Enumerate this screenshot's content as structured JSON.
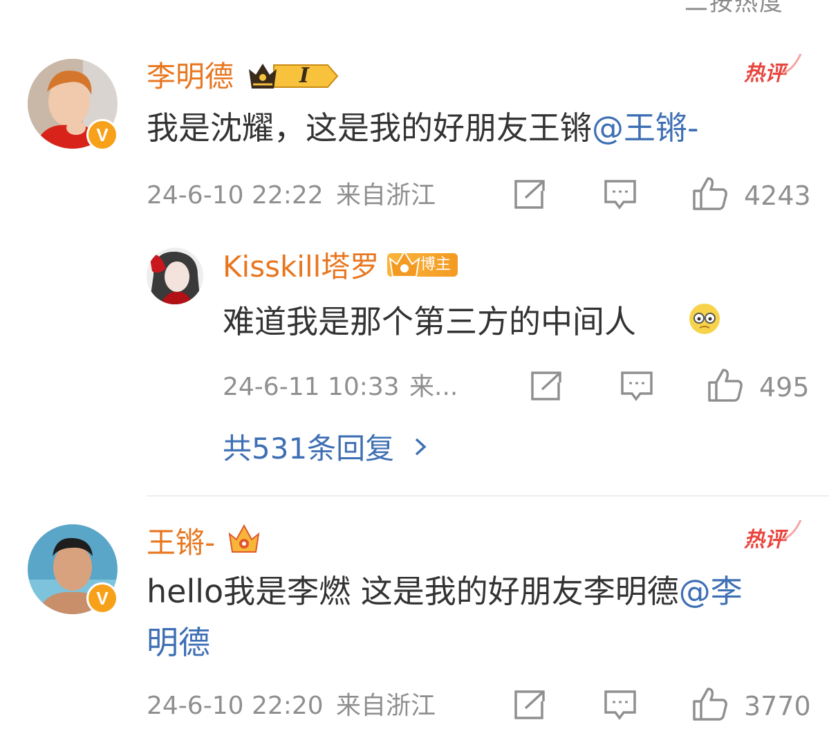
{
  "top_partial": "二按热度",
  "comments": [
    {
      "username": "李明德",
      "badge_text": "I",
      "hot_label": "热评",
      "text_main": "我是沈耀，这是我的好朋友王锵",
      "mention": "@王锵-",
      "time": "24-6-10 22:22",
      "location": "来自浙江",
      "likes": "4243",
      "reply": {
        "username": "Kisskill塔罗",
        "tag": "博主",
        "text": "难道我是那个第三方的中间人",
        "time": "24-6-11 10:33",
        "location": "来...",
        "likes": "495"
      },
      "replies_link": "共531条回复"
    },
    {
      "username": "王锵-",
      "hot_label": "热评",
      "text_main": "hello我是李燃 这是我的好朋友李明德",
      "mention_1": "@李",
      "mention_2": "明德",
      "time": "24-6-10 22:20",
      "location": "来自浙江",
      "likes": "3770"
    }
  ],
  "colors": {
    "username": "#e8761f",
    "mention": "#3e6fb4",
    "meta": "#8f8f8f",
    "hot": "#e8463f",
    "verified": "#f7a11a"
  },
  "icons": [
    "share-icon",
    "comment-icon",
    "like-icon",
    "chevron-right-icon",
    "crown-icon",
    "verified-icon",
    "emoji-icon"
  ]
}
